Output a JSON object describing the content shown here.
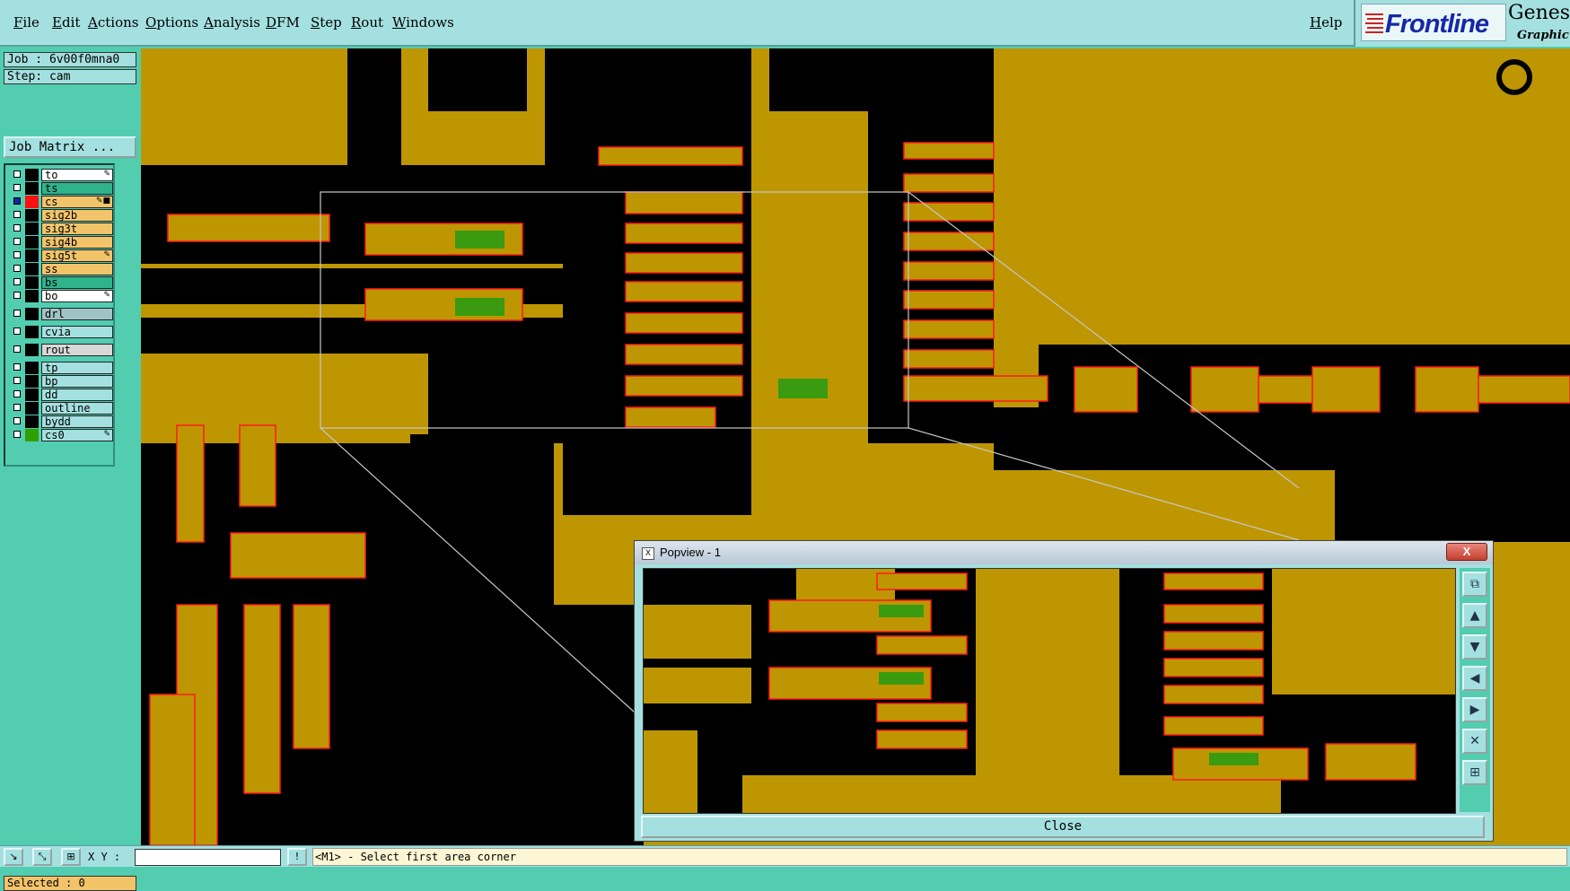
{
  "menu": {
    "items": [
      "File",
      "Edit",
      "Actions",
      "Options",
      "Analysis",
      "DFM",
      "Step",
      "Rout",
      "Windows"
    ],
    "help": "Help"
  },
  "logo": {
    "brand": "Frontline",
    "product": "Genesi",
    "sub": "Graphic"
  },
  "job": {
    "label": "Job : 6v00f0mna0",
    "step": "Step: cam",
    "matrix_button": "Job Matrix ..."
  },
  "layers": [
    {
      "name": "to",
      "color": "#ffffff",
      "swatch": "#000000",
      "selected": false,
      "marker": "✎"
    },
    {
      "name": "ts",
      "color": "#2fb38a",
      "swatch": "#000000",
      "selected": false,
      "marker": ""
    },
    {
      "name": "cs",
      "color": "#f2c46a",
      "swatch": "#ff1010",
      "selected": true,
      "marker": "✎■"
    },
    {
      "name": "sig2b",
      "color": "#f2c46a",
      "swatch": "#000000",
      "selected": false,
      "marker": ""
    },
    {
      "name": "sig3t",
      "color": "#f2c46a",
      "swatch": "#000000",
      "selected": false,
      "marker": ""
    },
    {
      "name": "sig4b",
      "color": "#f2c46a",
      "swatch": "#000000",
      "selected": false,
      "marker": ""
    },
    {
      "name": "sig5t",
      "color": "#f2c46a",
      "swatch": "#000000",
      "selected": false,
      "marker": "✎"
    },
    {
      "name": "ss",
      "color": "#f2c46a",
      "swatch": "#000000",
      "selected": false,
      "marker": ""
    },
    {
      "name": "bs",
      "color": "#2fb38a",
      "swatch": "#000000",
      "selected": false,
      "marker": ""
    },
    {
      "name": "bo",
      "color": "#ffffff",
      "swatch": "#000000",
      "selected": false,
      "marker": "✎"
    },
    {
      "name": "drl",
      "color": "#a0c4c4",
      "swatch": "#000000",
      "selected": false,
      "marker": ""
    },
    {
      "name": "cvia",
      "color": "#a5e0e0",
      "swatch": "#000000",
      "selected": false,
      "marker": ""
    },
    {
      "name": "rout",
      "color": "#d8d8d8",
      "swatch": "#000000",
      "selected": false,
      "marker": ""
    },
    {
      "name": "tp",
      "color": "#a5e0e0",
      "swatch": "#000000",
      "selected": false,
      "marker": ""
    },
    {
      "name": "bp",
      "color": "#a5e0e0",
      "swatch": "#000000",
      "selected": false,
      "marker": ""
    },
    {
      "name": "dd",
      "color": "#a5e0e0",
      "swatch": "#000000",
      "selected": false,
      "marker": ""
    },
    {
      "name": "outline",
      "color": "#a5e0e0",
      "swatch": "#000000",
      "selected": false,
      "marker": ""
    },
    {
      "name": "bydd",
      "color": "#a5e0e0",
      "swatch": "#000000",
      "selected": false,
      "marker": ""
    },
    {
      "name": "cs0",
      "color": "#a5e0e0",
      "swatch": "#30a000",
      "selected": false,
      "marker": "✎"
    }
  ],
  "selected": "Selected : 0",
  "popview": {
    "title": "Popview - 1",
    "close": "Close",
    "close_x": "X",
    "title_icon": "X"
  },
  "bottom": {
    "xy_label": "X Y :",
    "message": "<M1> - Select first area corner"
  },
  "colors": {
    "copper": "#be9602",
    "outline": "#ff1a1a",
    "highlight": "#3a9a10",
    "panel": "#52cdb0",
    "ui": "#a5e0e0"
  }
}
